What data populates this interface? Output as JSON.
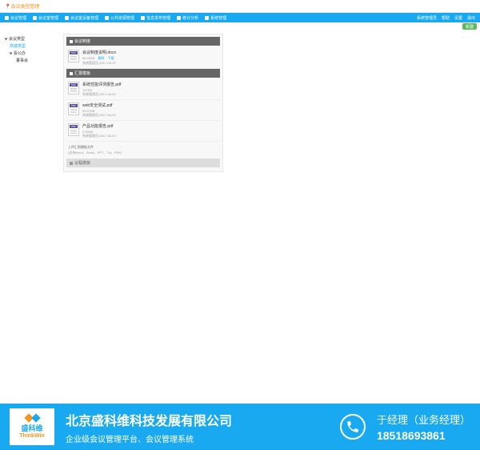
{
  "breadcrumb": {
    "icon": "📍",
    "text": "会议类型管理"
  },
  "nav": {
    "items": [
      {
        "label": "会议管理"
      },
      {
        "label": "会议室管理"
      },
      {
        "label": "会议室设备管理"
      },
      {
        "label": "公共资源管理"
      },
      {
        "label": "信息发布管理"
      },
      {
        "label": "统计分析"
      },
      {
        "label": "系统管理"
      }
    ],
    "right": [
      {
        "label": "系统管理员"
      },
      {
        "label": "帮助"
      },
      {
        "label": "设置"
      },
      {
        "label": "退出"
      }
    ]
  },
  "sub_bar": {
    "add_button": "新建"
  },
  "sidebar": {
    "root": "会议类型",
    "items": [
      {
        "label": "高端类型",
        "selected": true
      },
      {
        "label": "投公办",
        "children": [
          {
            "label": "董事会"
          }
        ]
      }
    ]
  },
  "sections": [
    {
      "title": "会议制度",
      "icon": "doc",
      "files": [
        {
          "badge": "DOC",
          "name": "会议制度说明.docx",
          "size": "56.33KB",
          "actions": [
            "删除",
            "下载"
          ],
          "uploader": "系统管理员",
          "date": "2017-06-19"
        }
      ]
    },
    {
      "title": "汇报模板",
      "icon": "doc",
      "files": [
        {
          "badge": "PDF",
          "name": "系统性能评测报告.pdf",
          "size": "137KB",
          "uploader": "系统管理员",
          "date": "2017-06-20"
        },
        {
          "badge": "PDF",
          "name": "web安全测试.pdf",
          "size": "93.57KB",
          "uploader": "系统管理员",
          "date": "2017-06-20"
        },
        {
          "badge": "PDF",
          "name": "产品功能报告.pdf",
          "size": "2.54KB",
          "uploader": "系统管理员",
          "date": "2017-06-20"
        }
      ],
      "upload_hint": {
        "t1": "上传汇报模板文件",
        "t2": "(支持Word、Excel、PPT、Txt、PDF)"
      }
    },
    {
      "title": "议程模板",
      "icon": "doc",
      "files": []
    }
  ],
  "footer": {
    "logo_cn": "盛科维",
    "logo_en": "ThinkWin",
    "company_name": "北京盛科维科技发展有限公司",
    "company_sub": "企业级会议管理平台、会议管理系统",
    "contact_name": "于经理（业务经理）",
    "contact_phone": "18518693861"
  }
}
